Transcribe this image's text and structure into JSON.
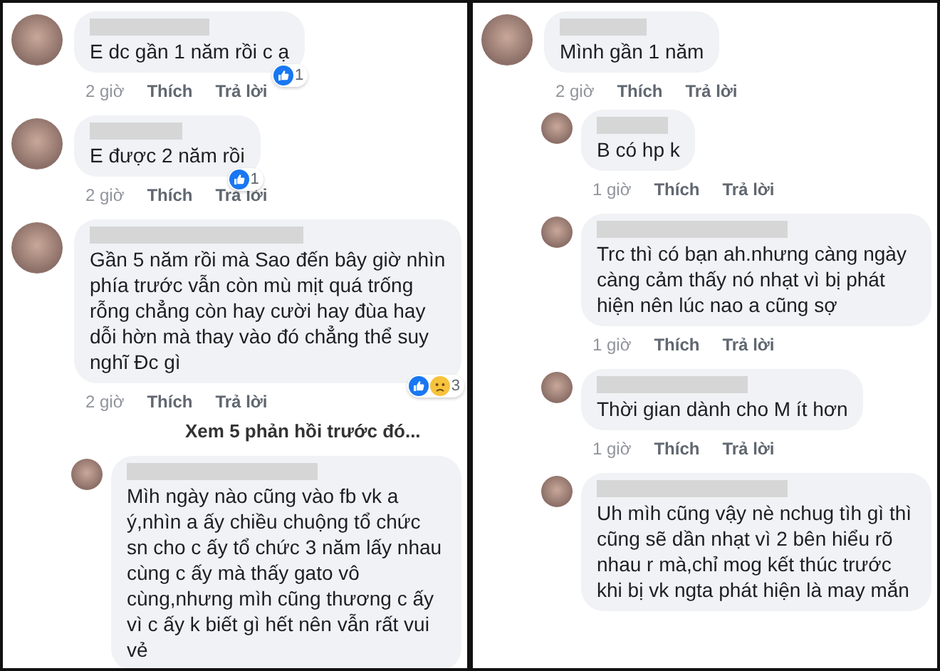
{
  "panels": [
    {
      "comments": [
        {
          "kind": "comment",
          "text": "E dc gần 1 năm rồi c ạ",
          "time": "2 giờ",
          "like": "Thích",
          "reply": "Trả lời",
          "reactions": [
            {
              "kind": "like"
            }
          ],
          "reaction_count": "1"
        },
        {
          "kind": "comment",
          "text": "E được 2 năm rồi",
          "time": "2 giờ",
          "like": "Thích",
          "reply": "Trả lời",
          "reactions": [
            {
              "kind": "like"
            }
          ],
          "reaction_count": "1"
        },
        {
          "kind": "comment",
          "text": "Gần 5 năm rồi mà Sao đến bây giờ nhìn phía trước vẫn còn mù mịt quá trống rỗng chẳng còn hay cười hay đùa hay dỗi hờn mà thay vào đó chẳng thể suy nghĩ Đc gì",
          "time": "2 giờ",
          "like": "Thích",
          "reply": "Trả lời",
          "reactions": [
            {
              "kind": "like"
            },
            {
              "kind": "sad"
            }
          ],
          "reaction_count": "3",
          "children": [
            {
              "kind": "more_link",
              "text": "Xem 5 phản hồi trước đó..."
            },
            {
              "kind": "comment",
              "text": "Mìh ngày nào cũng vào fb vk a ý,nhìn a ấy chiều chuộng tổ chức sn cho c ấy tổ chức 3 năm lấy nhau cùng c ấy mà thấy gato vô cùng,nhưng mìh cũng thương c ấy vì c ấy k biết gì hết nên vẫn rất vui vẻ"
            }
          ]
        }
      ]
    },
    {
      "comments": [
        {
          "kind": "comment",
          "text": "Mình gần 1 năm",
          "time": "2 giờ",
          "like": "Thích",
          "reply": "Trả lời",
          "children": [
            {
              "kind": "comment",
              "text": "B có hp k",
              "time": "1 giờ",
              "like": "Thích",
              "reply": "Trả lời"
            },
            {
              "kind": "comment",
              "text": "Trc thì có bạn ah.nhưng càng ngày càng cảm thấy nó nhạt vì bị phát hiện nên lúc nao a cũng sợ",
              "time": "1 giờ",
              "like": "Thích",
              "reply": "Trả lời"
            },
            {
              "kind": "comment",
              "text": "Thời gian dành cho M ít hơn",
              "time": "1 giờ",
              "like": "Thích",
              "reply": "Trả lời"
            },
            {
              "kind": "comment",
              "text": "Uh mìh cũng vậy nè nchug tìh gì thì cũng sẽ dần nhạt vì 2 bên hiểu rõ nhau r mà,chỉ mog kết thúc trước khi bị vk ngta phát hiện là may mắn"
            }
          ]
        }
      ]
    }
  ]
}
